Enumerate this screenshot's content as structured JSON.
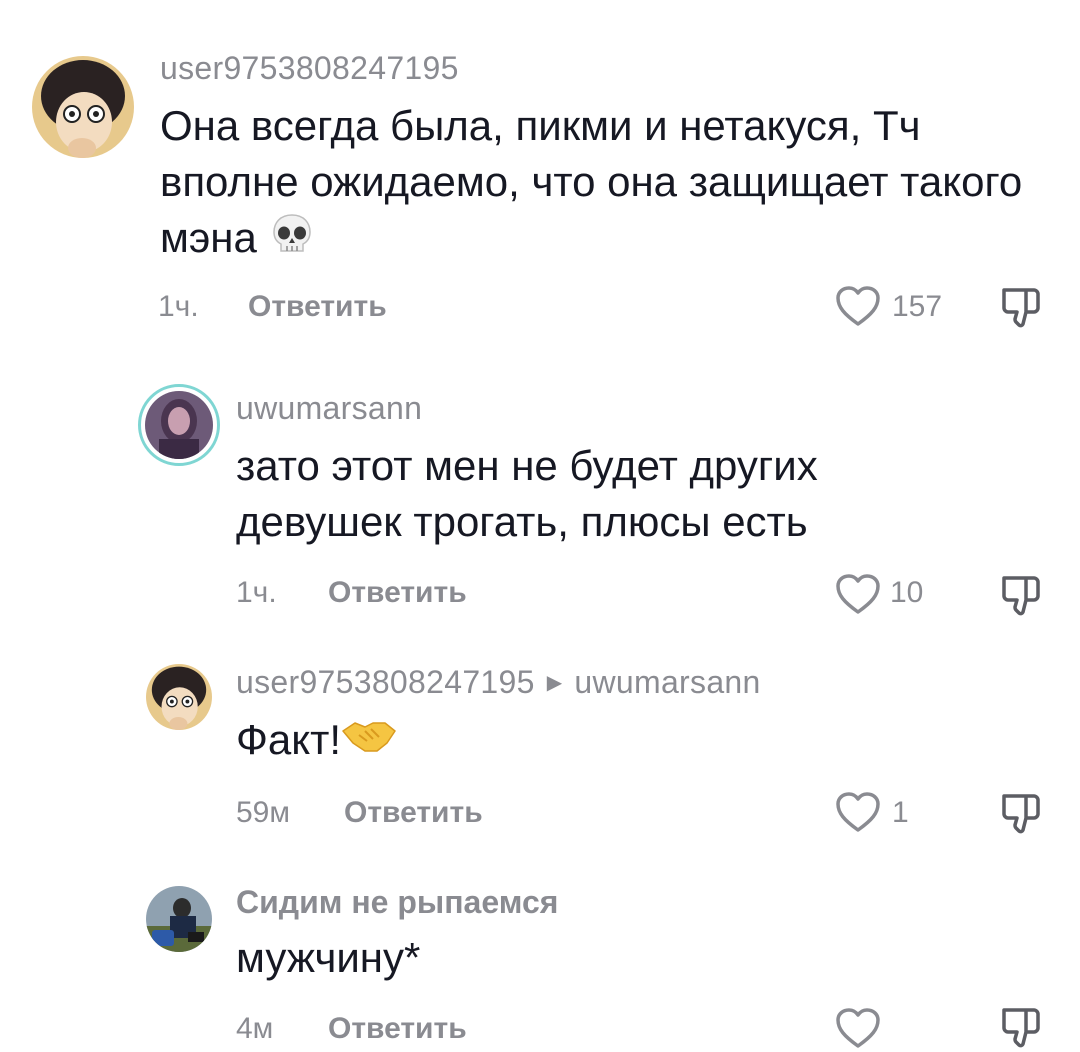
{
  "comments": [
    {
      "username": "user9753808247195",
      "text": "Она всегда была, пикми и нетакуся, Тч вполне ожидаемо, что она защищает такого мэна",
      "emoji": "skull",
      "time": "1ч.",
      "reply_label": "Ответить",
      "likes": "157"
    },
    {
      "username": "uwumarsann",
      "text": "зато этот мен не будет других девушек трогать, плюсы есть",
      "time": "1ч.",
      "reply_label": "Ответить",
      "likes": "10"
    },
    {
      "username": "user9753808247195",
      "reply_to": "uwumarsann",
      "text": "Факт!",
      "emoji": "handshake",
      "time": "59м",
      "reply_label": "Ответить",
      "likes": "1"
    },
    {
      "username": "Сидим не рыпаемся",
      "text": "мужчину*",
      "time": "4м",
      "reply_label": "Ответить",
      "likes": ""
    }
  ],
  "icons": [
    "heart-outline-icon",
    "thumbs-down-outline-icon",
    "skull-emoji",
    "handshake-emoji"
  ],
  "colors": {
    "text": "#161823",
    "secondary": "#8a8b91",
    "story_ring": "#7fd6d3"
  }
}
